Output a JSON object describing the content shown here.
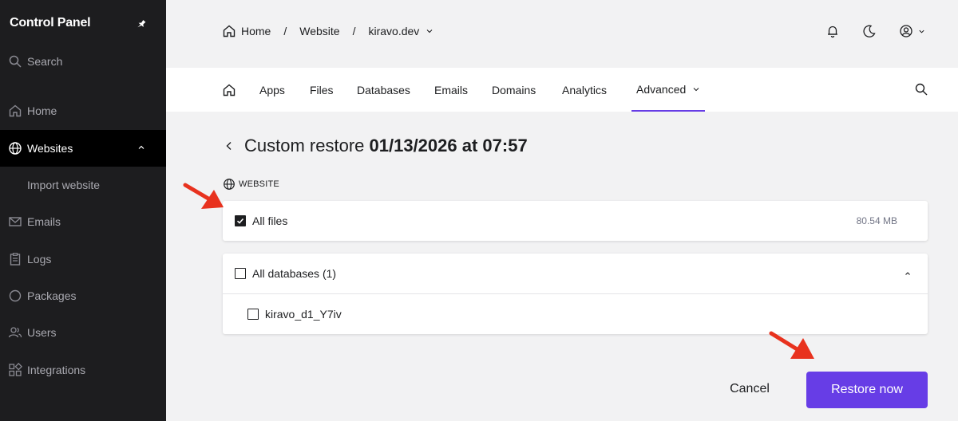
{
  "sidebar": {
    "brand": "Control Panel",
    "search_label": "Search",
    "items": [
      {
        "label": "Home",
        "icon": "home-icon"
      },
      {
        "label": "Websites",
        "icon": "globe-icon",
        "active": true
      },
      {
        "label": "Emails",
        "icon": "mail-icon"
      },
      {
        "label": "Logs",
        "icon": "clipboard-icon"
      },
      {
        "label": "Packages",
        "icon": "circle-icon"
      },
      {
        "label": "Users",
        "icon": "users-icon"
      },
      {
        "label": "Integrations",
        "icon": "grid-icon"
      }
    ],
    "subitem": "Import website"
  },
  "header": {
    "breadcrumb": [
      "Home",
      "Website",
      "kiravo.dev"
    ],
    "separator": "/"
  },
  "tabs": [
    "Apps",
    "Files",
    "Databases",
    "Emails",
    "Domains",
    "Analytics",
    "Advanced"
  ],
  "main": {
    "title_prefix": "Custom restore",
    "title_date": "01/13/2026 at 07:57",
    "section_label": "WEBSITE",
    "files": {
      "label": "All files",
      "size": "80.54 MB",
      "checked": true
    },
    "databases": {
      "label": "All databases (1)",
      "checked": false,
      "items": [
        "kiravo_d1_Y7iv"
      ]
    },
    "cancel_label": "Cancel",
    "restore_label": "Restore now"
  },
  "colors": {
    "accent": "#673de6",
    "arrow": "#e8321e",
    "sidebar": "#1d1d1f"
  }
}
